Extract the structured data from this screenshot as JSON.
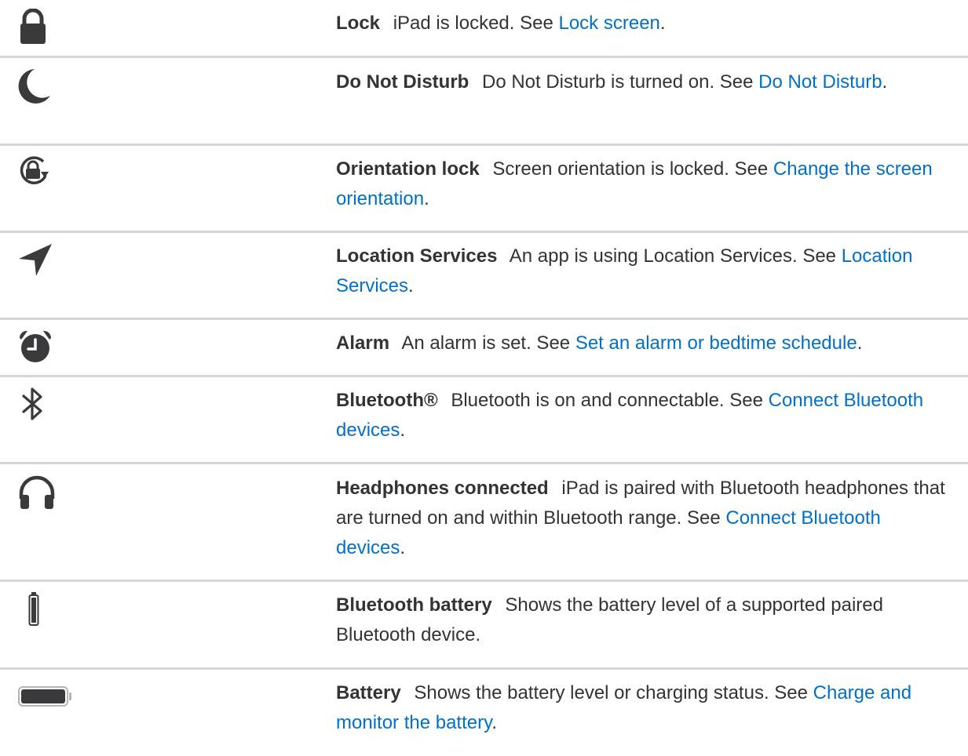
{
  "rows": [
    {
      "icon": "lock-icon",
      "term": "Lock",
      "desc": "iPad is locked. See ",
      "link": "Lock screen",
      "tail": "."
    },
    {
      "icon": "moon-icon",
      "term": "Do Not Disturb",
      "desc": "Do Not Disturb is turned on. See ",
      "link": "Do Not Disturb",
      "tail": "."
    },
    {
      "icon": "orientation-lock-icon",
      "term": "Orientation lock",
      "desc": "Screen orientation is locked. See ",
      "link": "Change the screen orientation",
      "tail": "."
    },
    {
      "icon": "location-arrow-icon",
      "term": "Location Services",
      "desc": "An app is using Location Services. See ",
      "link": "Location Services",
      "tail": "."
    },
    {
      "icon": "alarm-clock-icon",
      "term": "Alarm",
      "desc": "An alarm is set. See ",
      "link": "Set an alarm or bedtime schedule",
      "tail": "."
    },
    {
      "icon": "bluetooth-icon",
      "term": "Bluetooth®",
      "desc": "Bluetooth is on and connectable. See ",
      "link": "Connect Bluetooth devices",
      "tail": "."
    },
    {
      "icon": "headphones-icon",
      "term": "Headphones connected",
      "desc": "iPad is paired with Bluetooth headphones that are turned on and within Bluetooth range. See ",
      "link": "Connect Bluetooth devices",
      "tail": "."
    },
    {
      "icon": "bluetooth-battery-icon",
      "term": "Bluetooth battery",
      "desc": "Shows the battery level of a supported paired Bluetooth device.",
      "link": "",
      "tail": ""
    },
    {
      "icon": "battery-icon",
      "term": "Battery",
      "desc": "Shows the battery level or charging status. See ",
      "link": "Charge and monitor the battery",
      "tail": "."
    }
  ],
  "colors": {
    "icon": "#3a3a3c",
    "link": "#0070c9",
    "divider": "#d6d6d6"
  }
}
